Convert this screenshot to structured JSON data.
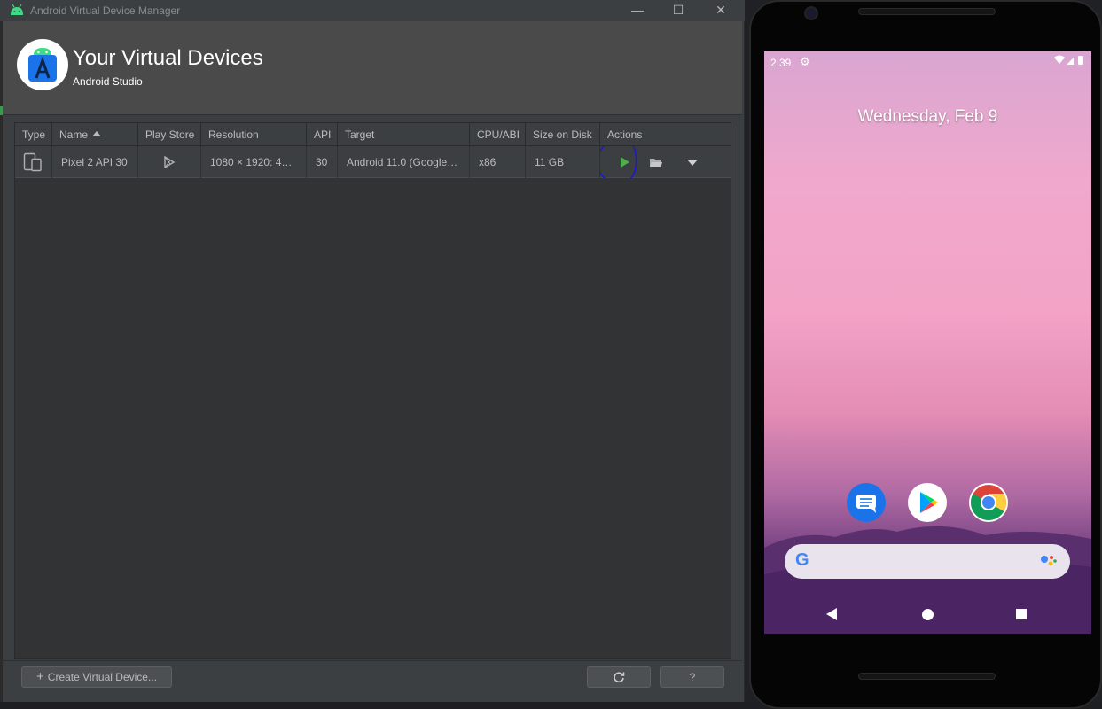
{
  "window": {
    "title": "Android Virtual Device Manager",
    "minimize_glyph": "—",
    "maximize_glyph": "☐",
    "close_glyph": "✕"
  },
  "header": {
    "title": "Your Virtual Devices",
    "subtitle": "Android Studio",
    "logo_icon": "android-studio-icon"
  },
  "table": {
    "columns": [
      "Type",
      "Name",
      "Play Store",
      "Resolution",
      "API",
      "Target",
      "CPU/ABI",
      "Size on Disk",
      "Actions"
    ],
    "sorted_column": "Name",
    "rows": [
      {
        "type_icon": "device-phone-tablet-icon",
        "name": "Pixel 2 API 30",
        "play_store_icon": "play-store-icon",
        "resolution": "1080 × 1920: 4…",
        "api": "30",
        "target": "Android 11.0 (Google…",
        "cpu_abi": "x86",
        "size_on_disk": "11 GB",
        "actions": [
          "launch-play-icon",
          "folder-icon",
          "dropdown-arrow-icon"
        ]
      }
    ],
    "annotation_color": "#1a1acc"
  },
  "footer": {
    "create_label": "Create Virtual Device...",
    "create_icon": "+",
    "refresh_icon": "refresh-icon",
    "help_label": "?"
  },
  "emulator": {
    "status_time": "2:39",
    "status_icons": "▾◢▮",
    "date": "Wednesday, Feb 9",
    "apps": [
      "messages-icon",
      "play-store-icon",
      "chrome-icon"
    ],
    "search_logo": "G",
    "nav": [
      "back-icon",
      "home-icon",
      "recents-icon"
    ]
  },
  "colors": {
    "play_green": "#4caf50",
    "header_bg": "#4a4a4a",
    "window_bg": "#3c3f41"
  }
}
